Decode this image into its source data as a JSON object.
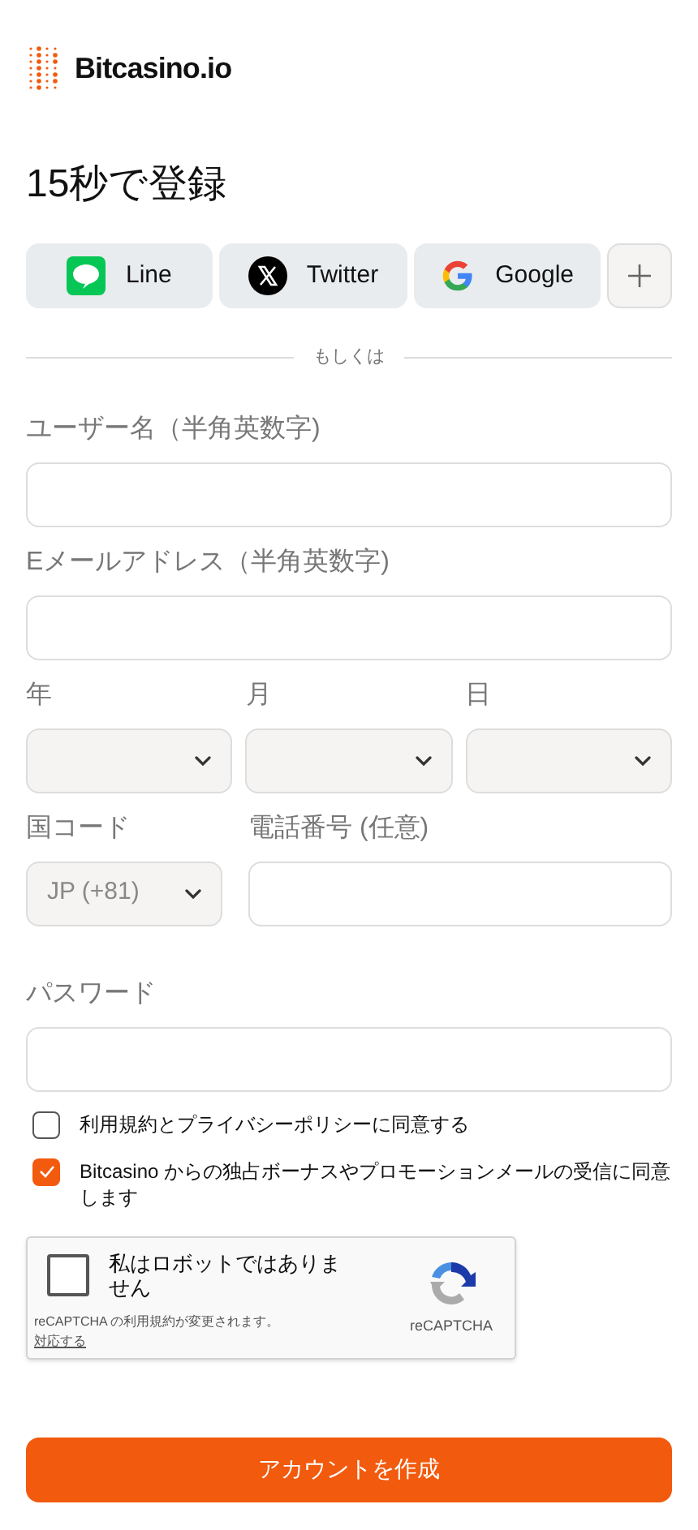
{
  "brand": {
    "name": "Bitcasino.io"
  },
  "title": "15秒で登録",
  "social_buttons": [
    {
      "kind": "line",
      "label": "Line"
    },
    {
      "kind": "twitter",
      "label": "Twitter"
    },
    {
      "kind": "google",
      "label": "Google"
    },
    {
      "kind": "more"
    }
  ],
  "divider_text": "もしくは",
  "username": {
    "label": "ユーザー名（半角英数字)"
  },
  "email": {
    "label": "Eメールアドレス（半角英数字)"
  },
  "birth_date": [
    {
      "label": "年"
    },
    {
      "label": "月"
    },
    {
      "label": "日"
    }
  ],
  "country_code": {
    "label": "国コード",
    "value": "JP (+81)"
  },
  "phone": {
    "label": "電話番号 (任意)"
  },
  "password": {
    "label": "パスワード"
  },
  "checkboxes": [
    {
      "label": "利用規約とプライバシーポリシーに同意する",
      "checked": false
    },
    {
      "label": "Bitcasino からの独占ボーナスやプロモーションメールの受信に同意します",
      "checked": true
    }
  ],
  "recaptcha": {
    "label": "私はロボットではありません",
    "checked": false,
    "brand": "reCAPTCHA",
    "notice": "reCAPTCHA の利用規約が変更されます。",
    "link": "対応する"
  },
  "submit": {
    "label": "アカウントを作成"
  }
}
